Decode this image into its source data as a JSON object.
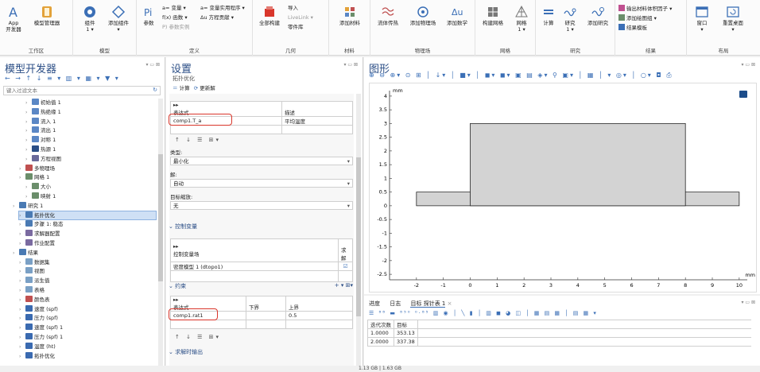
{
  "ribbon": {
    "groups": [
      {
        "label": "工作区"
      },
      {
        "label": "模型"
      },
      {
        "label": "定义"
      },
      {
        "label": "几何"
      },
      {
        "label": "材料"
      },
      {
        "label": "物理场"
      },
      {
        "label": "网格"
      },
      {
        "label": "研究"
      },
      {
        "label": "结果"
      },
      {
        "label": "布局"
      }
    ],
    "app_dev": "App\n开发器",
    "model_manager": "模型管理器",
    "component": "组件\n1 ▾",
    "add_component": "添加组件\n▾",
    "parameters": "参数",
    "variables": "a= 变量 ▾",
    "functions": "f(x) 函数 ▾",
    "param_case": "P) 参数实例",
    "var_util": "a= 变量实用程序 ▾",
    "eq_contrib": "Δu 方程贡献 ▾",
    "build_all": "全部构建",
    "import": "导入",
    "livelink": "LiveLink ▾",
    "parts": "零件库",
    "add_material": "添加材料",
    "fluid_heat": "流体传热",
    "add_physics": "添加物理场",
    "add_math": "添加数学",
    "build_mesh": "构建网格",
    "mesh": "网格\n1 ▾",
    "compute": "计算",
    "study": "研究\n1 ▾",
    "add_study": "添加研究",
    "material_factor": "输出材料体积因子 ▾",
    "add_plot": "添加绘图组 ▾",
    "result_template": "结果模板",
    "window": "窗口\n▾",
    "reset_desktop": "重置桌面\n▾"
  },
  "model_builder": {
    "title": "模型开发器",
    "filter_placeholder": "键入过滤文本",
    "tree": [
      {
        "label": "初始值 1",
        "indent": 2,
        "color": "#5b87c5"
      },
      {
        "label": "热绝缘 1",
        "indent": 2,
        "color": "#5b87c5"
      },
      {
        "label": "流入 1",
        "indent": 2,
        "color": "#5b87c5"
      },
      {
        "label": "流出 1",
        "indent": 2,
        "color": "#5b87c5"
      },
      {
        "label": "对称 1",
        "indent": 2,
        "color": "#5b87c5"
      },
      {
        "label": "热源 1",
        "indent": 2,
        "color": "#2b4e86"
      },
      {
        "label": "方程视图",
        "indent": 2,
        "color": "#6a6a9a"
      },
      {
        "label": "多物理场",
        "indent": 1,
        "color": "#c05050"
      },
      {
        "label": "网格 1",
        "indent": 1,
        "color": "#6b8e6b"
      },
      {
        "label": "大小",
        "indent": 2,
        "color": "#6b8e6b"
      },
      {
        "label": "映射 1",
        "indent": 2,
        "color": "#6b8e6b"
      },
      {
        "label": "研究 1",
        "indent": 0,
        "color": "#4a7ab3"
      },
      {
        "label": "拓扑优化",
        "indent": 1,
        "color": "#4a7ab3",
        "selected": true
      },
      {
        "label": "步骤 1: 稳态",
        "indent": 1,
        "color": "#4a7ab3"
      },
      {
        "label": "求解器配置",
        "indent": 1,
        "color": "#7a6aa0"
      },
      {
        "label": "作业配置",
        "indent": 1,
        "color": "#7a6aa0"
      },
      {
        "label": "结果",
        "indent": 0,
        "color": "#4a7ab3"
      },
      {
        "label": "数据集",
        "indent": 1,
        "color": "#7aa0c5"
      },
      {
        "label": "视图",
        "indent": 1,
        "color": "#7aa0c5"
      },
      {
        "label": "派生值",
        "indent": 1,
        "color": "#7aa0c5"
      },
      {
        "label": "表格",
        "indent": 1,
        "color": "#7aa0c5"
      },
      {
        "label": "颜色表",
        "indent": 1,
        "color": "#c05050"
      },
      {
        "label": "速度 (spf)",
        "indent": 1,
        "color": "#3a6ab0"
      },
      {
        "label": "压力 (spf)",
        "indent": 1,
        "color": "#3a6ab0"
      },
      {
        "label": "速度 (spf) 1",
        "indent": 1,
        "color": "#3a6ab0"
      },
      {
        "label": "压力 (spf) 1",
        "indent": 1,
        "color": "#3a6ab0"
      },
      {
        "label": "温度 (ht)",
        "indent": 1,
        "color": "#3a6ab0"
      },
      {
        "label": "拓扑优化",
        "indent": 1,
        "color": "#3a6ab0"
      }
    ]
  },
  "settings": {
    "title": "设置",
    "subtitle": "拓扑优化",
    "compute_btn": "计算",
    "update_btn": "更新解",
    "obj_table": {
      "h1": "表达式",
      "h2": "描述",
      "expr": "comp1.T_a",
      "desc": "平均温度"
    },
    "type_label": "类型:",
    "type_val": "最小化",
    "solution_label": "解:",
    "solution_val": "自动",
    "scale_label": "目标缩放:",
    "scale_val": "无",
    "control_section": "控制变量",
    "ctrl_table": {
      "h1": "控制变量场",
      "h2": "求解",
      "row": "密度模型 1 (dtopo1)"
    },
    "constraint_section": "约束",
    "cons_table": {
      "h1": "表达式",
      "h2": "下界",
      "h3": "上界",
      "expr": "comp1.rat1",
      "upper": "0.5"
    },
    "output_section": "求解时输出"
  },
  "graphics": {
    "title": "图形",
    "unit": "mm"
  },
  "chart_data": {
    "type": "area",
    "xlim": [
      -3,
      10.3
    ],
    "ylim": [
      -2.7,
      4.2
    ],
    "xticks": [
      -2,
      -1,
      0,
      1,
      2,
      3,
      4,
      5,
      6,
      7,
      8,
      9,
      10
    ],
    "yticks": [
      -2.5,
      -2,
      -1.5,
      -1,
      -0.5,
      0,
      0.5,
      1,
      1.5,
      2,
      2.5,
      3,
      3.5,
      4
    ],
    "xlabel": "mm",
    "ylabel": "mm",
    "shape": [
      [
        -2,
        0
      ],
      [
        0,
        0
      ],
      [
        0,
        3
      ],
      [
        8,
        3
      ],
      [
        8,
        0
      ],
      [
        10,
        0
      ],
      [
        10,
        0.5
      ],
      [
        8,
        0.5
      ],
      [
        8,
        3
      ],
      [
        0,
        3
      ],
      [
        0,
        0.5
      ],
      [
        -2,
        0.5
      ]
    ]
  },
  "bottom": {
    "tabs": [
      "进度",
      "日志",
      "目标 探针表 1"
    ],
    "col1": "迭代次数",
    "col2": "目标",
    "rows": [
      [
        "1.0000",
        "353.13"
      ],
      [
        "2.0000",
        "337.38"
      ]
    ]
  },
  "status": {
    "memory": "1.13 GB | 1.63 GB"
  }
}
